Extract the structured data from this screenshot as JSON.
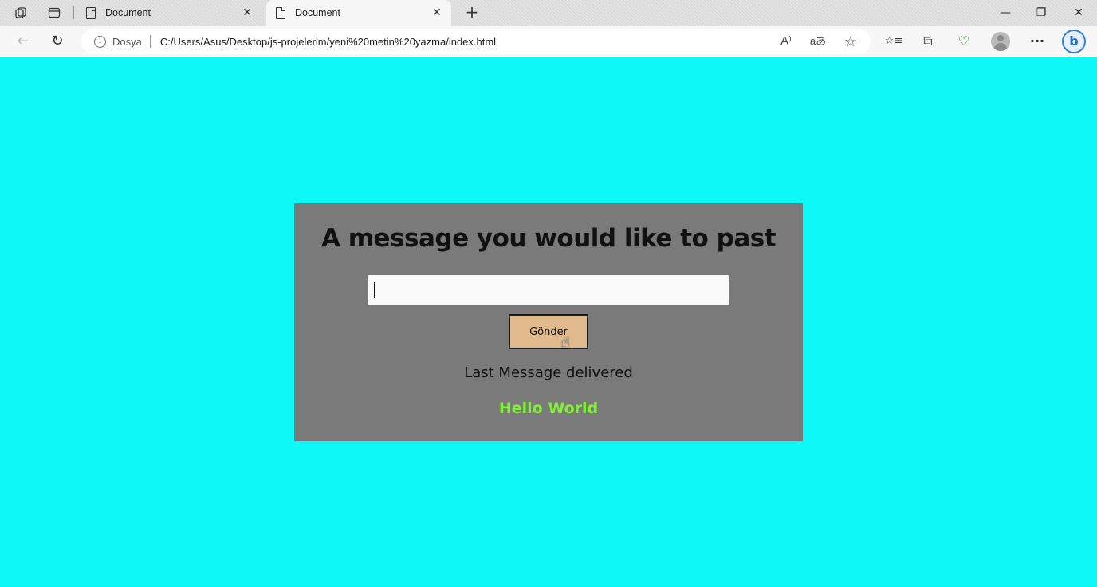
{
  "browser": {
    "tabs": [
      {
        "title": "Document",
        "active": false
      },
      {
        "title": "Document",
        "active": true
      }
    ],
    "site_label": "Dosya",
    "url": "C:/Users/Asus/Desktop/js-projelerim/yeni%20metin%20yazma/index.html",
    "icons": {
      "workspaces": "workspaces-icon",
      "tab_actions": "tab-actions-icon",
      "new_tab": "+",
      "minimize": "—",
      "restore": "❐",
      "close": "✕",
      "back": "←",
      "refresh": "↻",
      "info": "i",
      "read_aloud": "A⁾",
      "translate": "aあ",
      "favorite": "☆",
      "favorites": "☆≡",
      "collections": "⧉",
      "performance": "♡",
      "more": "···",
      "copilot": "b"
    }
  },
  "page": {
    "background": "#0ff8f8",
    "card_color": "#7a7a7a",
    "title": "A message you would like to past",
    "input_value": "",
    "button_label": "Gönder",
    "button_color": "#e0b98c",
    "last_label": "Last Message delivered",
    "last_message": "Hello World",
    "last_message_color": "#7df232"
  }
}
